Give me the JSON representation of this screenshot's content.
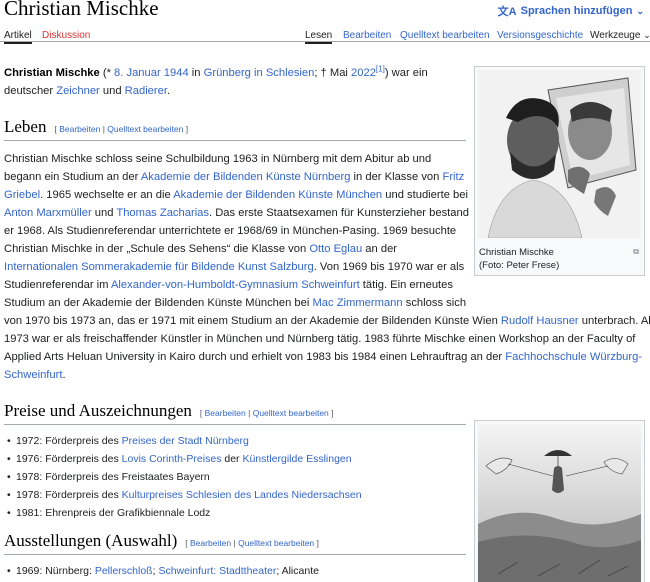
{
  "header": {
    "title": "Christian Mischke",
    "language_button": "Sprachen hinzufügen",
    "language_icon": "translate-icon"
  },
  "tabs": {
    "left": [
      {
        "label": "Artikel",
        "active": true
      },
      {
        "label": "Diskussion",
        "red": true
      }
    ],
    "right": [
      {
        "label": "Lesen",
        "active": true
      },
      {
        "label": "Bearbeiten"
      },
      {
        "label": "Quelltext bearbeiten"
      },
      {
        "label": "Versionsgeschichte"
      },
      {
        "label": "Werkzeuge"
      }
    ]
  },
  "intro": {
    "name": "Christian Mischke",
    "t1": " (* ",
    "birth_date": "8. Januar 1944",
    "t2": " in ",
    "birth_place": "Grünberg in Schlesien",
    "t3": "; † Mai ",
    "death_year": "2022",
    "ref": "[1]",
    "t4": ") war ein",
    "t5": "deutscher ",
    "job1": "Zeichner",
    "t6": " und ",
    "job2": "Radierer",
    "t7": "."
  },
  "edit": {
    "open": "[ ",
    "bearbeiten": "Bearbeiten",
    "sep": " | ",
    "quelltext": "Quelltext bearbeiten",
    "close": " ]"
  },
  "leben": {
    "heading": "Leben",
    "lines": {
      "l1": "Christian Mischke schloss seine Schulbildung 1963 in Nürnberg mit dem Abitur ab und",
      "l2a": "begann ein Studium an der ",
      "l2b": "Akademie der Bildenden Künste Nürnberg",
      "l2c": " in der Klasse von ",
      "l2d": "Fritz",
      "l3a": "Griebel",
      "l3b": ". 1965 wechselte er an die ",
      "l3c": "Akademie der Bildenden Künste München",
      "l3d": " und studierte bei",
      "l4a": "Anton Marxmüller",
      "l4b": " und ",
      "l4c": "Thomas Zacharias",
      "l4d": ". Das erste Staatsexamen für Kunsterzieher bestand",
      "l5": "er 1968. Als Studienreferendar unterrichtete er 1968/69 in München-Pasing. 1969 besuchte",
      "l6a": "Christian Mischke in der „Schule des Sehens“ die Klasse von ",
      "l6b": "Otto Eglau",
      "l6c": " an der",
      "l7a": "Internationalen Sommerakademie für Bildende Kunst Salzburg",
      "l7b": ". Von 1969 bis 1970 war er als",
      "l8a": "Studienreferendar im ",
      "l8b": "Alexander-von-Humboldt-Gymnasium Schweinfurt",
      "l8c": " tätig. Ein erneutes",
      "l9a": "Studium an der Akademie der Bildenden Künste München bei ",
      "l9b": "Mac Zimmermann",
      "l9c": " schloss sich",
      "l10a": "von 1970 bis 1973 an, das er 1971 mit einem Studium an der Akademie der Bildenden Künste Wien ",
      "l10b": "Rudolf Hausner",
      "l10c": " unterbrach. Ab",
      "l11": "1973 war er als freischaffender Künstler in München und Nürnberg tätig. 1983 führte Mischke einen Workshop an der Faculty of",
      "l12a": "Applied Arts Heluan University in Kairo durch und erhielt von 1983 bis 1984 einen Lehrauftrag an der ",
      "l12b": "Fachhochschule Würzburg-",
      "l13a": "Schweinfurt",
      "l13b": "."
    }
  },
  "thumb1": {
    "caption1": "Christian Mischke",
    "caption2": "(Foto: Peter Frese)"
  },
  "preise": {
    "heading": "Preise und Auszeichnungen",
    "items": [
      {
        "a": "1972: Förderpreis des ",
        "b": "Preises der Stadt Nürnberg",
        "c": "",
        "d": "",
        "e": ""
      },
      {
        "a": "1976: Förderpreis des ",
        "b": "Lovis Corinth-Preises",
        "c": " der ",
        "d": "Künstlergilde Esslingen",
        "e": ""
      },
      {
        "a": "1978: Förderpreis des Freistaates Bayern",
        "b": "",
        "c": "",
        "d": "",
        "e": ""
      },
      {
        "a": "1978: Förderpreis des ",
        "b": "Kulturpreises Schlesien des Landes Niedersachsen",
        "c": "",
        "d": "",
        "e": ""
      },
      {
        "a": "1981: Ehrenpreis der Grafikbiennale Lodz",
        "b": "",
        "c": "",
        "d": "",
        "e": ""
      }
    ]
  },
  "ausstellungen": {
    "heading": "Ausstellungen (Auswahl)",
    "items": [
      {
        "a": "1969: Nürnberg: ",
        "b": "Pellerschloß",
        "c": "; ",
        "d": "Schweinfurt: Stadttheater",
        "e": "; Alicante"
      }
    ]
  }
}
